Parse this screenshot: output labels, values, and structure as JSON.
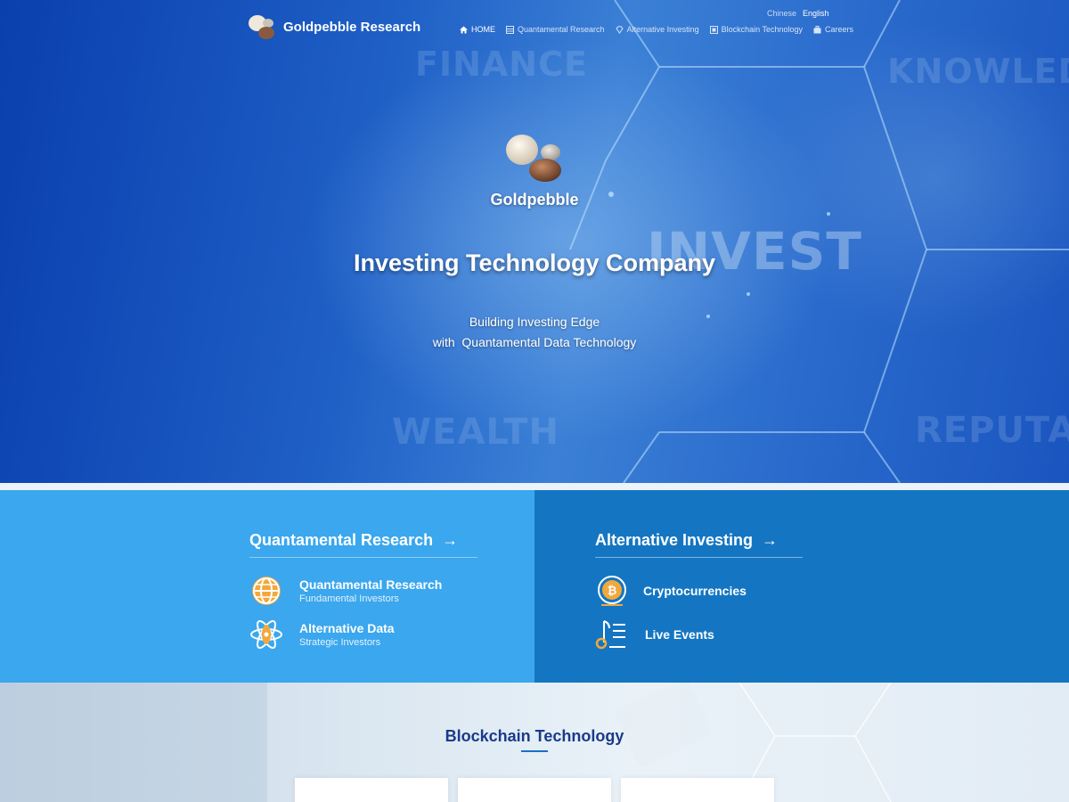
{
  "header": {
    "brand": "Goldpebble Research",
    "languages": [
      {
        "label": "Chinese",
        "active": false
      },
      {
        "label": "English",
        "active": true
      }
    ],
    "nav": [
      {
        "label": "HOME",
        "icon": "home-icon",
        "active": true
      },
      {
        "label": "Quantamental Research",
        "icon": "grid-icon",
        "active": false
      },
      {
        "label": "Alternative Investing",
        "icon": "diamond-icon",
        "active": false
      },
      {
        "label": "Blockchain Technology",
        "icon": "blockchain-icon",
        "active": false
      },
      {
        "label": "Careers",
        "icon": "briefcase-icon",
        "active": false
      }
    ]
  },
  "hero": {
    "brand": "Goldpebble",
    "title": "Investing Technology Company",
    "subtitle_line1": "Building Investing Edge",
    "subtitle_line2": "with  Quantamental Data Technology",
    "background_words": [
      "FINANCE",
      "KNOWLED",
      "INVEST",
      "WEALTH",
      "REPUTA"
    ]
  },
  "services": {
    "left": {
      "title": "Quantamental Research",
      "arrow": "→",
      "items": [
        {
          "name": "Quantamental Research",
          "desc": "Fundamental Investors",
          "icon": "globe-icon"
        },
        {
          "name": "Alternative Data",
          "desc": "Strategic Investors",
          "icon": "atom-icon"
        }
      ]
    },
    "right": {
      "title": "Alternative Investing",
      "arrow": "→",
      "items": [
        {
          "name": "Cryptocurrencies",
          "icon": "bitcoin-icon"
        },
        {
          "name": "Live Events",
          "icon": "music-note-list-icon"
        }
      ]
    }
  },
  "blockchain": {
    "title": "Blockchain Technology"
  },
  "colors": {
    "hero_blue": "#1f60c6",
    "panel_light": "#3aa7ee",
    "panel_dark": "#1476c2",
    "heading_navy": "#1a3a8a"
  }
}
